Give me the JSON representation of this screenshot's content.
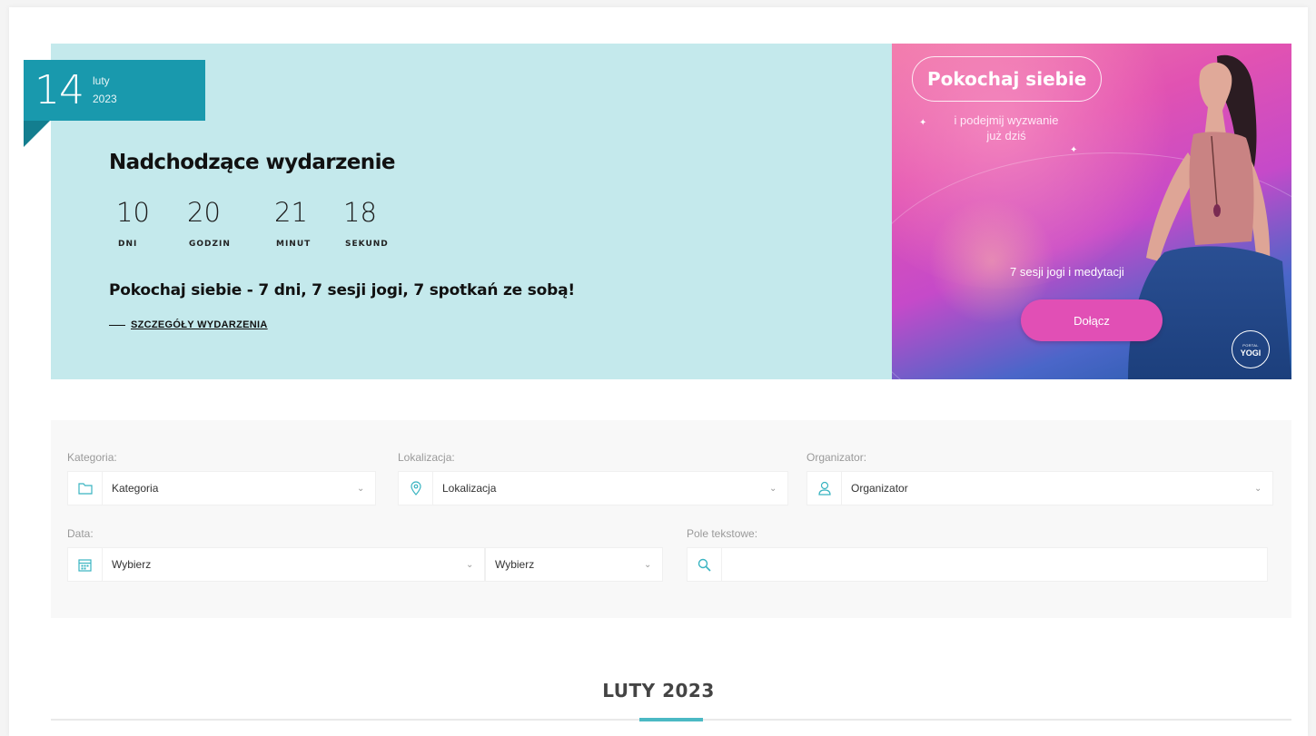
{
  "hero": {
    "date": {
      "day": "14",
      "month": "luty",
      "year": "2023"
    },
    "heading": "Nadchodzące wydarzenie",
    "countdown": [
      {
        "value": "10",
        "label": "DNI"
      },
      {
        "value": "20",
        "label": "GODZIN"
      },
      {
        "value": "21",
        "label": "MINUT"
      },
      {
        "value": "18",
        "label": "SEKUND"
      }
    ],
    "event_title": "Pokochaj siebie - 7 dni, 7 sesji jogi, 7 spotkań ze sobą!",
    "details_link": "SZCZEGÓŁY WYDARZENIA"
  },
  "promo": {
    "title": "Pokochaj siebie",
    "subtitle_line1": "i podejmij wyzwanie",
    "subtitle_line2": "już dziś",
    "tagline": "7 sesji jogi i medytacji",
    "button": "Dołącz",
    "logo_small": "PORTAL",
    "logo_big": "YOGI"
  },
  "filters": {
    "category": {
      "label": "Kategoria:",
      "value": "Kategoria"
    },
    "location": {
      "label": "Lokalizacja:",
      "value": "Lokalizacja"
    },
    "organizer": {
      "label": "Organizator:",
      "value": "Organizator"
    },
    "date": {
      "label": "Data:",
      "from": "Wybierz",
      "to": "Wybierz"
    },
    "text": {
      "label": "Pole tekstowe:",
      "placeholder": ""
    }
  },
  "month": {
    "title": "LUTY 2023"
  },
  "colors": {
    "hero_bg": "#c4e9ec",
    "ribbon": "#1999ad",
    "accent": "#4bb9c4",
    "promo_button": "#e14fb5"
  }
}
